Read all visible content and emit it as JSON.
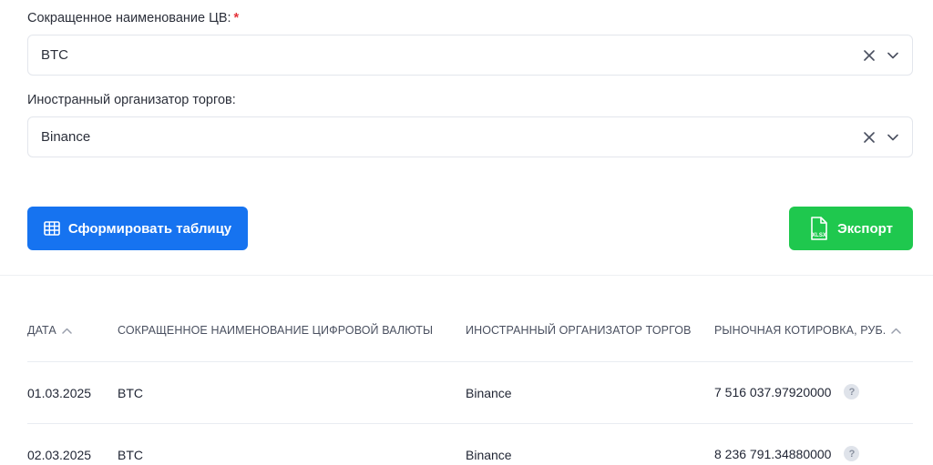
{
  "form": {
    "currency_field": {
      "label": "Сокращенное наименование ЦВ:",
      "required_mark": "*",
      "value": "BTC"
    },
    "organizer_field": {
      "label": "Иностранный организатор торгов:",
      "value": "Binance"
    }
  },
  "actions": {
    "build_table_label": "Сформировать таблицу",
    "export_label": "Экспорт",
    "export_icon_text": "XLSX"
  },
  "table": {
    "headers": {
      "date": "ДАТА",
      "currency": "СОКРАЩЕННОЕ НАИМЕНОВАНИЕ ЦИФРОВОЙ ВАЛЮТЫ",
      "organizer": "ИНОСТРАННЫЙ ОРГАНИЗАТОР ТОРГОВ",
      "quote": "РЫНОЧНАЯ КОТИРОВКА, РУБ."
    },
    "rows": [
      {
        "date": "01.03.2025",
        "currency": "BTC",
        "organizer": "Binance",
        "quote": "7 516 037.97920000"
      },
      {
        "date": "02.03.2025",
        "currency": "BTC",
        "organizer": "Binance",
        "quote": "8 236 791.34880000"
      }
    ],
    "help_glyph": "?"
  },
  "colors": {
    "primary": "#1673f0",
    "success": "#1fc84e",
    "required": "#e5343b"
  }
}
